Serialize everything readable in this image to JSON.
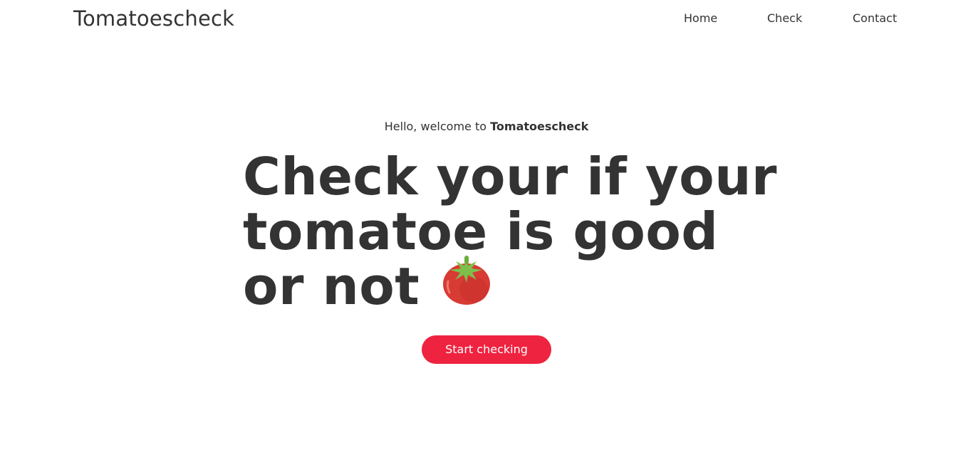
{
  "brand": {
    "name": "Tomatoescheck"
  },
  "nav": {
    "items": [
      {
        "label": "Home"
      },
      {
        "label": "Check"
      },
      {
        "label": "Contact"
      }
    ]
  },
  "hero": {
    "welcome_prefix": "Hello, welcome to",
    "welcome_brand": "Tomatoescheck",
    "headline_lines": [
      "Check your if your",
      "tomatoe is good",
      "or not"
    ],
    "headline_icon": "tomato-icon",
    "cta_label": "Start checking"
  },
  "colors": {
    "text": "#333333",
    "accent": "#ee2340",
    "background": "#ffffff"
  }
}
